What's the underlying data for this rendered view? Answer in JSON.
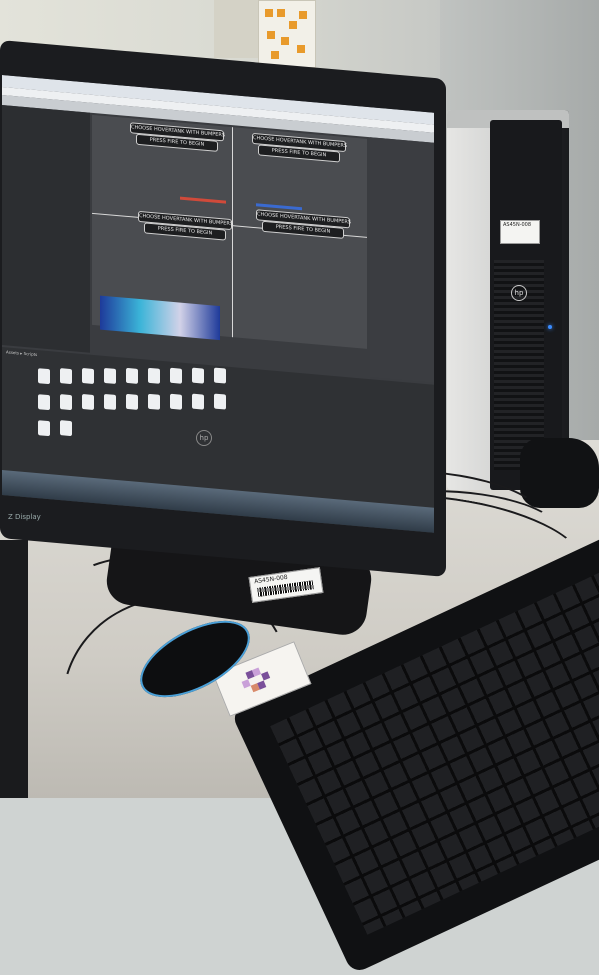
{
  "photo": {
    "subject": "computer workstation",
    "colors": {
      "wall": "#e0e0d8",
      "desk": "#d6d3cc",
      "hardware": "#18191c",
      "accent_blue": "#3a8cff"
    }
  },
  "monitor": {
    "brand_logo": "hp",
    "corner_label": "Z Display",
    "game_view": {
      "prompts": [
        {
          "line1": "CHOOSE HOVERTANK WITH BUMPERS",
          "line2": "PRESS FIRE TO BEGIN"
        },
        {
          "line1": "CHOOSE HOVERTANK WITH BUMPERS",
          "line2": "PRESS FIRE TO BEGIN"
        },
        {
          "line1": "CHOOSE HOVERTANK WITH BUMPERS",
          "line2": "PRESS FIRE TO BEGIN"
        },
        {
          "line1": "CHOOSE HOVERTANK WITH BUMPERS",
          "line2": "PRESS FIRE TO BEGIN"
        }
      ]
    },
    "project_panel": {
      "breadcrumb": "Assets ▸ Scripts"
    }
  },
  "tower": {
    "brand_logo": "hp",
    "asset_tag": "AS45N-008"
  },
  "monitor_stand": {
    "asset_tag": "AS45N-008"
  }
}
